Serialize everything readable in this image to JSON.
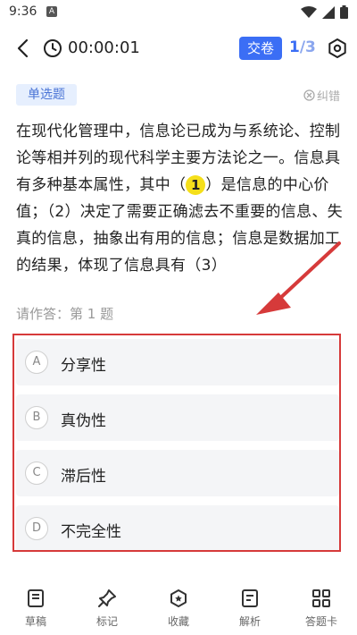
{
  "status": {
    "time": "9:36",
    "a_label": "A"
  },
  "header": {
    "timer": "00:00:01",
    "submit_label": "交卷",
    "progress_current": "1",
    "progress_total": "/3"
  },
  "question": {
    "type_label": "单选题",
    "report_label": "纠错",
    "text_before": "在现代化管理中，信息论已成为与系统论、控制论等相并列的现代科学主要方法论之一。信息具有多种基本属性，其中（",
    "highlight_number": "1",
    "text_after": "）是信息的中心价值；（2）决定了需要正确滤去不重要的信息、失真的信息，抽象出有用的信息；信息是数据加工的结果，体现了信息具有（3）",
    "prompt": "请作答：第 1 题"
  },
  "options": [
    {
      "letter": "A",
      "text": "分享性"
    },
    {
      "letter": "B",
      "text": "真伪性"
    },
    {
      "letter": "C",
      "text": "滞后性"
    },
    {
      "letter": "D",
      "text": "不完全性"
    }
  ],
  "nav": [
    {
      "label": "草稿",
      "icon": "draft-icon"
    },
    {
      "label": "标记",
      "icon": "pin-icon"
    },
    {
      "label": "收藏",
      "icon": "collect-icon"
    },
    {
      "label": "解析",
      "icon": "analysis-icon"
    },
    {
      "label": "答题卡",
      "icon": "answer-card-icon"
    }
  ],
  "colors": {
    "accent": "#3b6ef5",
    "highlight": "#f5df1a",
    "annotation": "#d63a3a"
  }
}
